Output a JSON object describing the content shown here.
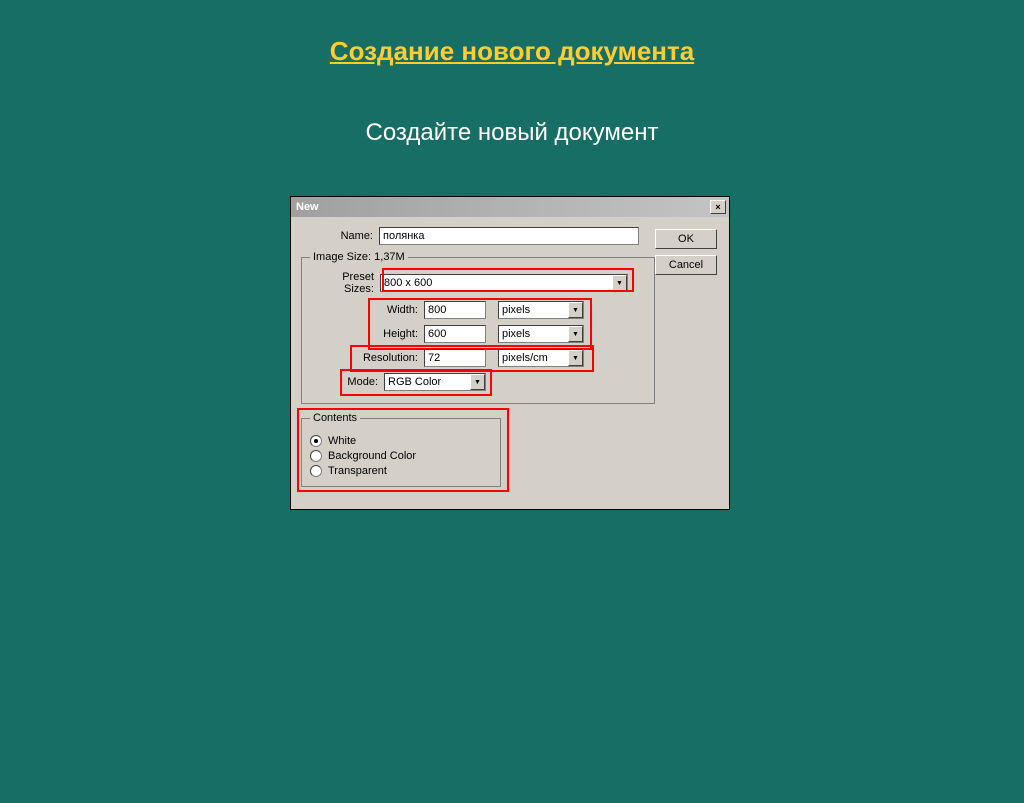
{
  "slide": {
    "title": "Создание нового документа",
    "subtitle": "Создайте новый документ"
  },
  "dialog": {
    "title": "New",
    "buttons": {
      "ok": "OK",
      "cancel": "Cancel"
    },
    "name_label": "Name:",
    "name_value": "полянка",
    "image_size_legend": "Image Size: 1,37M",
    "preset_label": "Preset Sizes:",
    "preset_value": "800 x 600",
    "width_label": "Width:",
    "width_value": "800",
    "width_unit": "pixels",
    "height_label": "Height:",
    "height_value": "600",
    "height_unit": "pixels",
    "res_label": "Resolution:",
    "res_value": "72",
    "res_unit": "pixels/cm",
    "mode_label": "Mode:",
    "mode_value": "RGB Color",
    "contents_legend": "Contents",
    "contents": {
      "white": "White",
      "bg": "Background Color",
      "transparent": "Transparent"
    }
  }
}
